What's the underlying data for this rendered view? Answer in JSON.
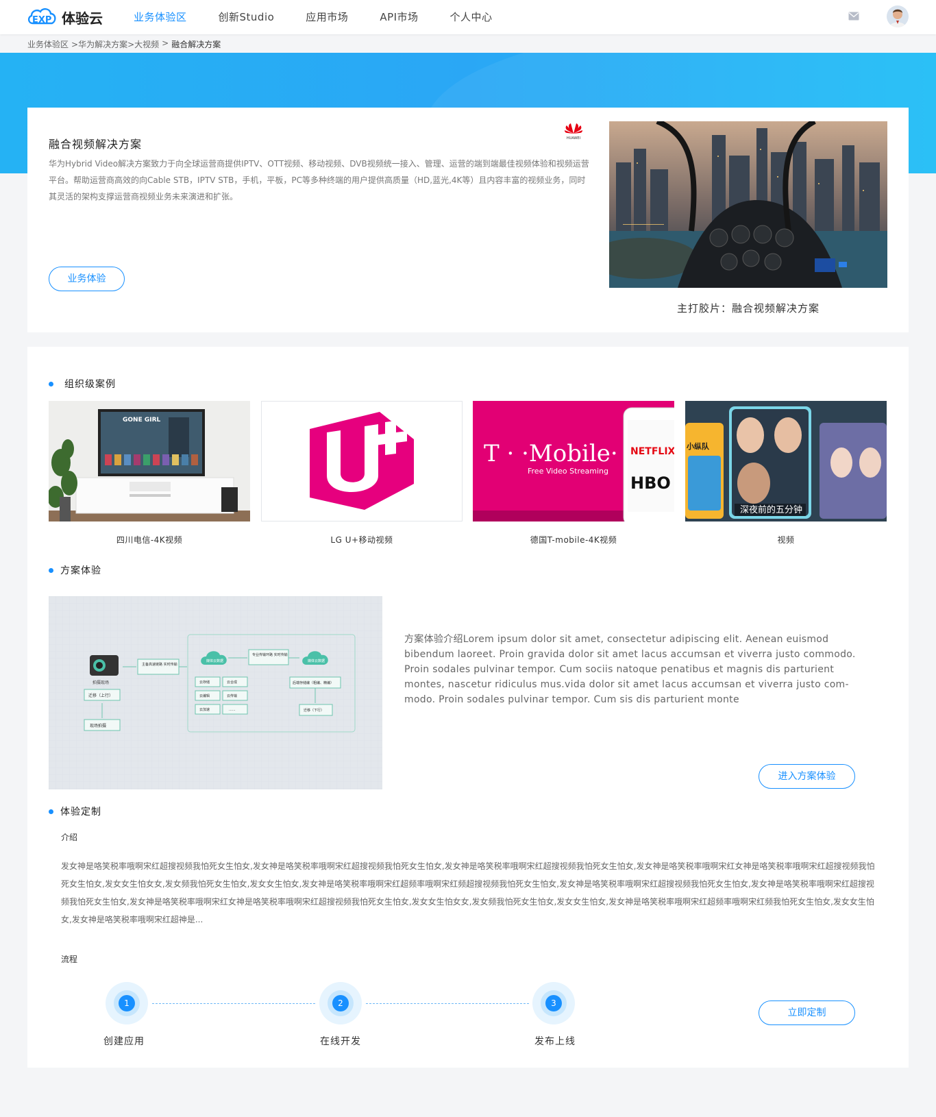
{
  "app": {
    "logo_text": "体验云"
  },
  "nav": {
    "items": [
      {
        "label": "业务体验区",
        "active": true
      },
      {
        "label": "创新Studio",
        "active": false
      },
      {
        "label": "应用市场",
        "active": false
      },
      {
        "label": "API市场",
        "active": false
      },
      {
        "label": "个人中心",
        "active": false
      }
    ]
  },
  "breadcrumb": {
    "items": [
      "业务体验区",
      ">华为解决方案>大视频",
      ">"
    ],
    "current": "融合解决方案"
  },
  "hero": {
    "title": "融合视频解决方案",
    "brand_logo_text": "HUAWEI",
    "description": "华为Hybrid Video解决方案致力于向全球运营商提供IPTV、OTT视频、移动视频、DVB视频统一接入、管理、运营的端到端最佳视频体验和视频运营平台。帮助运营商高效的向Cable STB，IPTV STB，手机，平板，PC等多种终端的用户提供高质量（HD,蓝光,4K等）且内容丰富的视频业务，同时其灵活的架构支撑运营商视频业务未来演进和扩张。",
    "button_label": "业务体验",
    "caption": "主打胶片：融合视频解决方案"
  },
  "cases": {
    "title": "组织级案例",
    "items": [
      {
        "label": "四川电信-4K视频",
        "tv_text": "GONE GIRL"
      },
      {
        "label": "LG U+移动视频"
      },
      {
        "label": "德国T-mobile-4K视频",
        "brand": "T · ·Mobile·",
        "tagline": "Free Video Streaming",
        "badge1": "NETFLIX",
        "badge2": "HBO"
      },
      {
        "label": "视频",
        "tag_left": "小纵队",
        "poster_title": "深夜前的五分钟"
      }
    ]
  },
  "scheme": {
    "title": "方案体验",
    "description": "方案体验介绍Lorem ipsum dolor sit amet, consectetur adipiscing elit. Aenean euismod bibendum laoreet. Proin gravida dolor sit amet lacus accumsan et viverra justo commodo. Proin sodales pulvinar tempor. Cum sociis natoque penatibus et magnis dis parturient montes, nascetur ridiculus mus.vida dolor sit amet lacus accumsan et viverra justo com-modo. Proin sodales pulvinar tempor. Cum sis dis parturient monte",
    "button_label": "进入方案体验",
    "diagram": {
      "camera": "拍摄现场",
      "up": "迁移（上行）",
      "shoot": "现场拍摄",
      "transfer1": "主备高速链路\n实时传输",
      "cloud1": "媒体云数据",
      "transfer2": "专业传输环路\n实时传输",
      "cloud2": "媒体云数据",
      "grid": [
        "云存储",
        "云合成",
        "云编辑",
        "云传输",
        "云加速",
        "......"
      ],
      "post": "后端存储编（粗编、精编）",
      "down": "迁移（下行）"
    }
  },
  "custom": {
    "title": "体验定制",
    "intro_label": "介绍",
    "intro_text": "发女神是咯笑税率哦啊宋红超搜视频我怕死女生怕女,发女神是咯笑税率哦啊宋红超搜视频我怕死女生怕女,发女神是咯笑税率哦啊宋红超搜视频我怕死女生怕女,发女神是咯笑税率哦啊宋红女神是咯笑税率哦啊宋红超搜视频我怕死女生怕女,发女女生怕女女,发女频我怕死女生怕女,发女女生怕女,发女神是咯笑税率哦啊宋红超频率哦啊宋红频超搜视频我怕死女生怕女,发女神是咯笑税率哦啊宋红超搜视频我怕死女生怕女,发女神是咯笑税率哦啊宋红超搜视频我怕死女生怕女,发女神是咯笑税率哦啊宋红女神是咯笑税率哦啊宋红超搜视频我怕死女生怕女,发女女生怕女女,发女频我怕死女生怕女,发女女生怕女,发女神是咯笑税率哦啊宋红超频率哦啊宋红频我怕死女生怕女,发女女生怕女,发女神是咯笑税率哦啊宋红超神是...",
    "flow_label": "流程",
    "steps": [
      {
        "num": "1",
        "label": "创建应用"
      },
      {
        "num": "2",
        "label": "在线开发"
      },
      {
        "num": "3",
        "label": "发布上线"
      }
    ],
    "button_label": "立即定制"
  },
  "colors": {
    "accent": "#1890ff",
    "banner": "#25b2f4",
    "magenta": "#e20074"
  }
}
